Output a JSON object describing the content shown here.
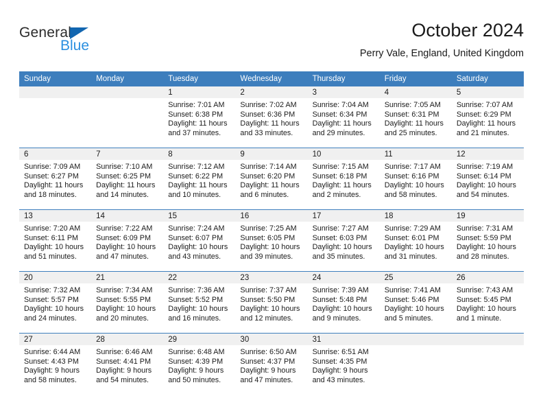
{
  "brand": {
    "word1": "General",
    "word2": "Blue",
    "triangle_color": "#1266b0",
    "blue_text_color": "#2a8fe0"
  },
  "header": {
    "title": "October 2024",
    "subtitle": "Perry Vale, England, United Kingdom"
  },
  "theme": {
    "header_row_bg": "#3d7ebd",
    "header_row_text": "#ffffff",
    "daynum_strip_bg": "#f0f0f0",
    "row_divider": "#3d7ebd"
  },
  "weekdays": [
    "Sunday",
    "Monday",
    "Tuesday",
    "Wednesday",
    "Thursday",
    "Friday",
    "Saturday"
  ],
  "labels": {
    "sunrise": "Sunrise:",
    "sunset": "Sunset:",
    "daylight": "Daylight:"
  },
  "weeks": [
    [
      {
        "day": "",
        "empty": true
      },
      {
        "day": "",
        "empty": true
      },
      {
        "day": "1",
        "sunrise": "Sunrise: 7:01 AM",
        "sunset": "Sunset: 6:38 PM",
        "daylight": "Daylight: 11 hours and 37 minutes."
      },
      {
        "day": "2",
        "sunrise": "Sunrise: 7:02 AM",
        "sunset": "Sunset: 6:36 PM",
        "daylight": "Daylight: 11 hours and 33 minutes."
      },
      {
        "day": "3",
        "sunrise": "Sunrise: 7:04 AM",
        "sunset": "Sunset: 6:34 PM",
        "daylight": "Daylight: 11 hours and 29 minutes."
      },
      {
        "day": "4",
        "sunrise": "Sunrise: 7:05 AM",
        "sunset": "Sunset: 6:31 PM",
        "daylight": "Daylight: 11 hours and 25 minutes."
      },
      {
        "day": "5",
        "sunrise": "Sunrise: 7:07 AM",
        "sunset": "Sunset: 6:29 PM",
        "daylight": "Daylight: 11 hours and 21 minutes."
      }
    ],
    [
      {
        "day": "6",
        "sunrise": "Sunrise: 7:09 AM",
        "sunset": "Sunset: 6:27 PM",
        "daylight": "Daylight: 11 hours and 18 minutes."
      },
      {
        "day": "7",
        "sunrise": "Sunrise: 7:10 AM",
        "sunset": "Sunset: 6:25 PM",
        "daylight": "Daylight: 11 hours and 14 minutes."
      },
      {
        "day": "8",
        "sunrise": "Sunrise: 7:12 AM",
        "sunset": "Sunset: 6:22 PM",
        "daylight": "Daylight: 11 hours and 10 minutes."
      },
      {
        "day": "9",
        "sunrise": "Sunrise: 7:14 AM",
        "sunset": "Sunset: 6:20 PM",
        "daylight": "Daylight: 11 hours and 6 minutes."
      },
      {
        "day": "10",
        "sunrise": "Sunrise: 7:15 AM",
        "sunset": "Sunset: 6:18 PM",
        "daylight": "Daylight: 11 hours and 2 minutes."
      },
      {
        "day": "11",
        "sunrise": "Sunrise: 7:17 AM",
        "sunset": "Sunset: 6:16 PM",
        "daylight": "Daylight: 10 hours and 58 minutes."
      },
      {
        "day": "12",
        "sunrise": "Sunrise: 7:19 AM",
        "sunset": "Sunset: 6:14 PM",
        "daylight": "Daylight: 10 hours and 54 minutes."
      }
    ],
    [
      {
        "day": "13",
        "sunrise": "Sunrise: 7:20 AM",
        "sunset": "Sunset: 6:11 PM",
        "daylight": "Daylight: 10 hours and 51 minutes."
      },
      {
        "day": "14",
        "sunrise": "Sunrise: 7:22 AM",
        "sunset": "Sunset: 6:09 PM",
        "daylight": "Daylight: 10 hours and 47 minutes."
      },
      {
        "day": "15",
        "sunrise": "Sunrise: 7:24 AM",
        "sunset": "Sunset: 6:07 PM",
        "daylight": "Daylight: 10 hours and 43 minutes."
      },
      {
        "day": "16",
        "sunrise": "Sunrise: 7:25 AM",
        "sunset": "Sunset: 6:05 PM",
        "daylight": "Daylight: 10 hours and 39 minutes."
      },
      {
        "day": "17",
        "sunrise": "Sunrise: 7:27 AM",
        "sunset": "Sunset: 6:03 PM",
        "daylight": "Daylight: 10 hours and 35 minutes."
      },
      {
        "day": "18",
        "sunrise": "Sunrise: 7:29 AM",
        "sunset": "Sunset: 6:01 PM",
        "daylight": "Daylight: 10 hours and 31 minutes."
      },
      {
        "day": "19",
        "sunrise": "Sunrise: 7:31 AM",
        "sunset": "Sunset: 5:59 PM",
        "daylight": "Daylight: 10 hours and 28 minutes."
      }
    ],
    [
      {
        "day": "20",
        "sunrise": "Sunrise: 7:32 AM",
        "sunset": "Sunset: 5:57 PM",
        "daylight": "Daylight: 10 hours and 24 minutes."
      },
      {
        "day": "21",
        "sunrise": "Sunrise: 7:34 AM",
        "sunset": "Sunset: 5:55 PM",
        "daylight": "Daylight: 10 hours and 20 minutes."
      },
      {
        "day": "22",
        "sunrise": "Sunrise: 7:36 AM",
        "sunset": "Sunset: 5:52 PM",
        "daylight": "Daylight: 10 hours and 16 minutes."
      },
      {
        "day": "23",
        "sunrise": "Sunrise: 7:37 AM",
        "sunset": "Sunset: 5:50 PM",
        "daylight": "Daylight: 10 hours and 12 minutes."
      },
      {
        "day": "24",
        "sunrise": "Sunrise: 7:39 AM",
        "sunset": "Sunset: 5:48 PM",
        "daylight": "Daylight: 10 hours and 9 minutes."
      },
      {
        "day": "25",
        "sunrise": "Sunrise: 7:41 AM",
        "sunset": "Sunset: 5:46 PM",
        "daylight": "Daylight: 10 hours and 5 minutes."
      },
      {
        "day": "26",
        "sunrise": "Sunrise: 7:43 AM",
        "sunset": "Sunset: 5:45 PM",
        "daylight": "Daylight: 10 hours and 1 minute."
      }
    ],
    [
      {
        "day": "27",
        "sunrise": "Sunrise: 6:44 AM",
        "sunset": "Sunset: 4:43 PM",
        "daylight": "Daylight: 9 hours and 58 minutes."
      },
      {
        "day": "28",
        "sunrise": "Sunrise: 6:46 AM",
        "sunset": "Sunset: 4:41 PM",
        "daylight": "Daylight: 9 hours and 54 minutes."
      },
      {
        "day": "29",
        "sunrise": "Sunrise: 6:48 AM",
        "sunset": "Sunset: 4:39 PM",
        "daylight": "Daylight: 9 hours and 50 minutes."
      },
      {
        "day": "30",
        "sunrise": "Sunrise: 6:50 AM",
        "sunset": "Sunset: 4:37 PM",
        "daylight": "Daylight: 9 hours and 47 minutes."
      },
      {
        "day": "31",
        "sunrise": "Sunrise: 6:51 AM",
        "sunset": "Sunset: 4:35 PM",
        "daylight": "Daylight: 9 hours and 43 minutes."
      },
      {
        "day": "",
        "empty": true
      },
      {
        "day": "",
        "empty": true
      }
    ]
  ]
}
